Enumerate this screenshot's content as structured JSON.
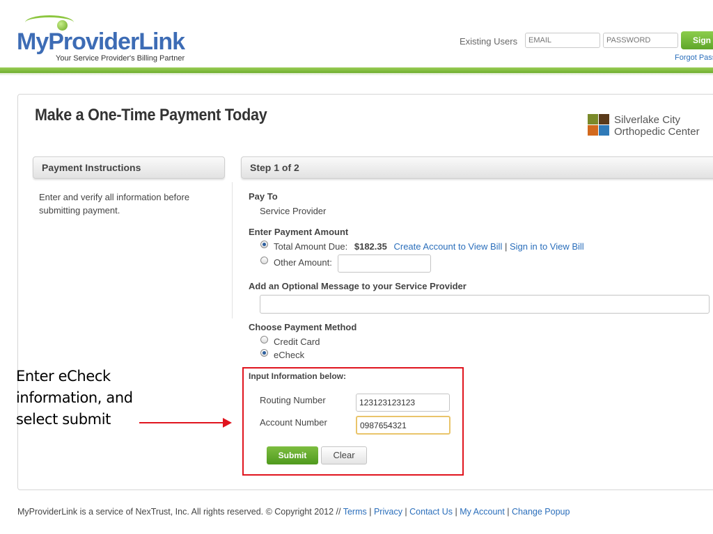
{
  "header": {
    "logo_main": "MyProvider",
    "logo_link": "Link",
    "tagline": "Your Service Provider's Billing Partner",
    "existing_users_label": "Existing Users",
    "email_placeholder": "EMAIL",
    "password_placeholder": "PASSWORD",
    "sign_in_label": "Sign",
    "forgot_label": "Forgot Pass"
  },
  "page": {
    "title": "Make a One-Time Payment Today",
    "org_name_line1": "Silverlake City",
    "org_name_line2": "Orthopedic Center"
  },
  "instructions": {
    "heading": "Payment Instructions",
    "text": "Enter and verify all information before submitting payment."
  },
  "form": {
    "step_label": "Step 1 of 2",
    "pay_to_label": "Pay To",
    "pay_to_value": "Service Provider",
    "amount_label": "Enter Payment Amount",
    "total_due_label": "Total Amount Due:",
    "total_due_value": "$182.35",
    "create_account_link": "Create Account to View Bill",
    "separator": "|",
    "sign_in_view_link": "Sign in to View Bill",
    "other_amount_label": "Other Amount:",
    "message_label": "Add an Optional Message to your Service Provider",
    "method_label": "Choose Payment Method",
    "credit_card_label": "Credit Card",
    "echeck_label": "eCheck",
    "input_info_label": "Input Information below:",
    "routing_label": "Routing Number",
    "routing_value": "123123123123",
    "account_label": "Account Number",
    "account_value": "0987654321",
    "submit_label": "Submit",
    "clear_label": "Clear",
    "selected_amount_option": "Total Amount Due",
    "selected_payment_method": "eCheck"
  },
  "annotation": {
    "line1": "Enter eCheck",
    "line2": "information, and",
    "line3": "select submit"
  },
  "footer": {
    "text": "MyProviderLink is a service of NexTrust, Inc. All rights reserved. © Copyright 2012 //",
    "links": [
      "Terms",
      "Privacy",
      "Contact Us",
      "My Account",
      "Change Popup"
    ]
  },
  "colors": {
    "brand_blue": "#3d6cb5",
    "brand_green": "#6fae2f",
    "link_blue": "#2a6ebb",
    "callout_red": "#e0141e"
  },
  "icons": {
    "logo_ball": "green-ball-icon",
    "org_logo": "four-squares-logo-icon",
    "arrow": "right-arrow-icon"
  }
}
